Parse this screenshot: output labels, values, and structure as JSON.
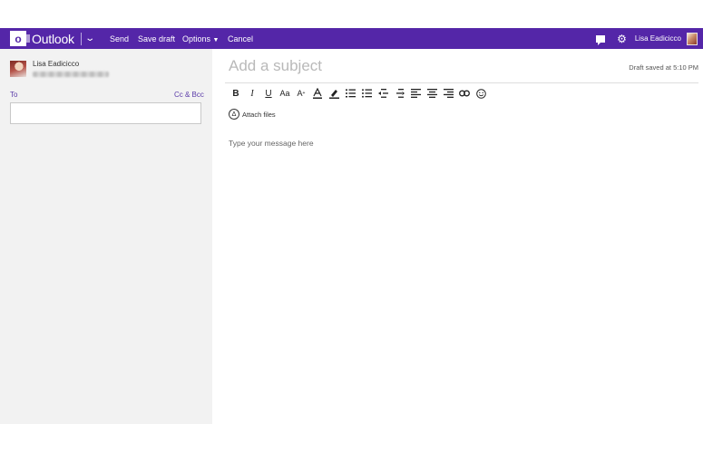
{
  "topbar": {
    "logo_letter": "o",
    "brand": "Outlook",
    "buttons": {
      "send": "Send",
      "save_draft": "Save draft",
      "options": "Options",
      "cancel": "Cancel"
    },
    "user_name": "Lisa Eadicicco"
  },
  "sender": {
    "name": "Lisa Eadicicco"
  },
  "recipients": {
    "to_label": "To",
    "cc_bcc_label": "Cc & Bcc",
    "to_value": ""
  },
  "compose": {
    "subject_placeholder": "Add a subject",
    "draft_status": "Draft saved at 5:10 PM",
    "attach_label": "Attach files",
    "body_placeholder": "Type your message here"
  },
  "colors": {
    "accent": "#5426a8",
    "link": "#5a3aa8"
  },
  "format_toolbar": {
    "items": [
      "bold-icon",
      "italic-icon",
      "underline-icon",
      "font-size-icon",
      "grow-font-icon",
      "font-color-icon",
      "highlight-icon",
      "numbered-list-icon",
      "bulleted-list-icon",
      "decrease-indent-icon",
      "increase-indent-icon",
      "align-left-icon",
      "align-center-icon",
      "align-right-icon",
      "link-icon",
      "emoji-icon"
    ]
  }
}
